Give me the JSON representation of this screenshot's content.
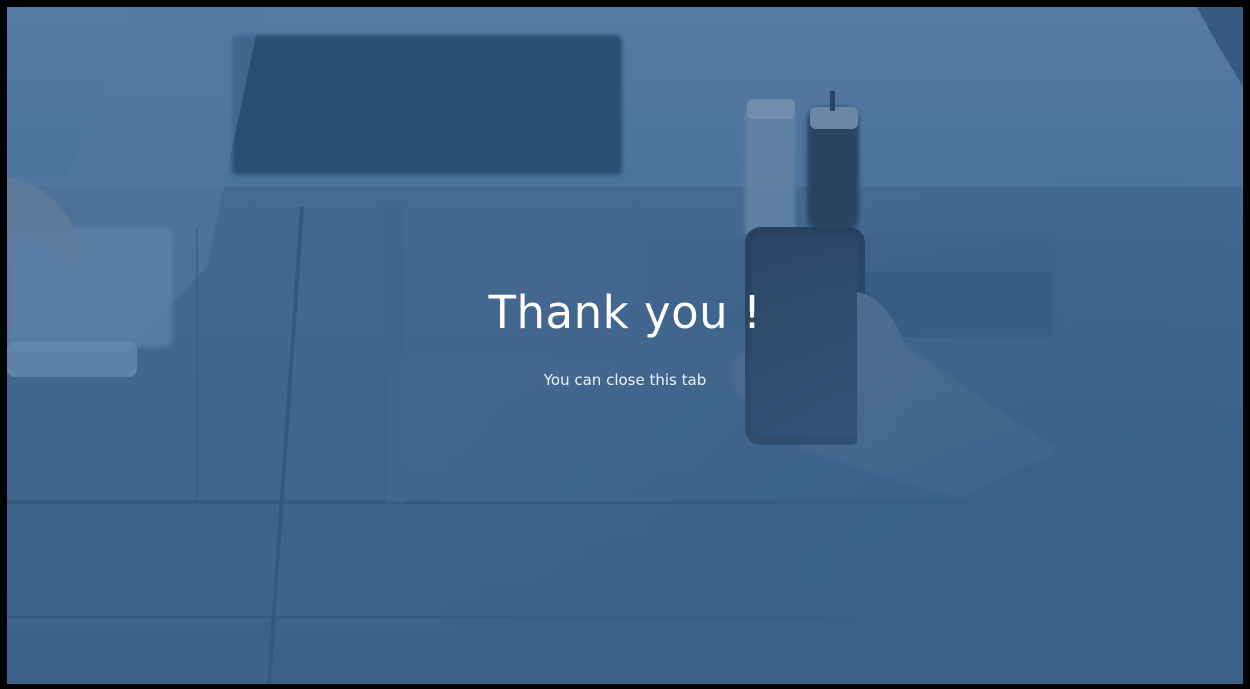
{
  "page": {
    "title": "Thank you !",
    "subtitle": "You can close this tab"
  },
  "background": {
    "description_icon": "office-desk-photo",
    "tint_color": "#2f5b88"
  }
}
